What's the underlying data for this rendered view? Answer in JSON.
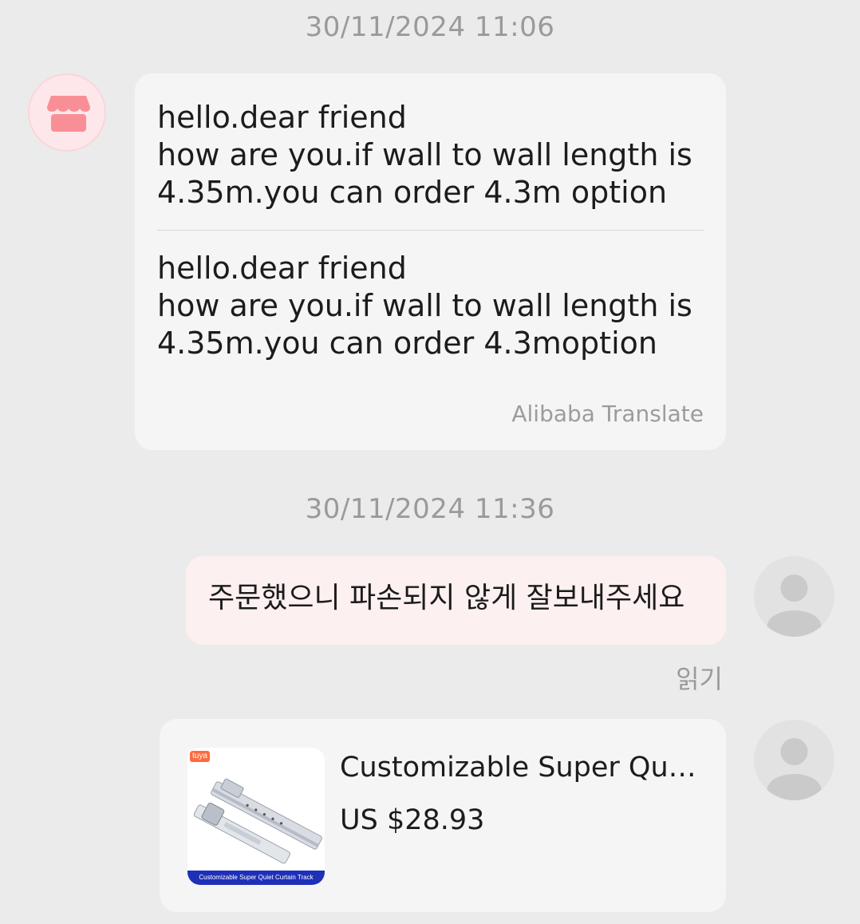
{
  "conversation": {
    "timestamps": [
      "30/11/2024 11:06",
      "30/11/2024 11:36"
    ],
    "incoming_message": {
      "original_text": "hello.dear friend\nhow are you.if wall to wall length is\n4.35m.you can order 4.3m option",
      "translated_text": "hello.dear friend\nhow are you.if wall to wall length is\n4.35m.you can order 4.3moption",
      "translation_label": "Alibaba Translate",
      "avatar_icon": "store-icon"
    },
    "outgoing_message": {
      "text": "주문했으니 파손되지 않게 잘보내주세요",
      "read_status": "읽기",
      "avatar_icon": "user-silhouette-icon"
    },
    "product_card": {
      "title": "Customizable Super Quiet Curtain Track",
      "price": "US $28.93",
      "thumbnail": {
        "brand_badge": "tuya",
        "caption": "Customizable Super Quiet Curtain Track"
      }
    }
  },
  "colors": {
    "background": "#ebebeb",
    "incoming_bubble": "#f5f5f5",
    "outgoing_bubble": "#fdf0f0",
    "seller_avatar_bg": "#fde7ea",
    "store_icon": "#f98f96",
    "secondary_text": "#9a9a9a"
  }
}
